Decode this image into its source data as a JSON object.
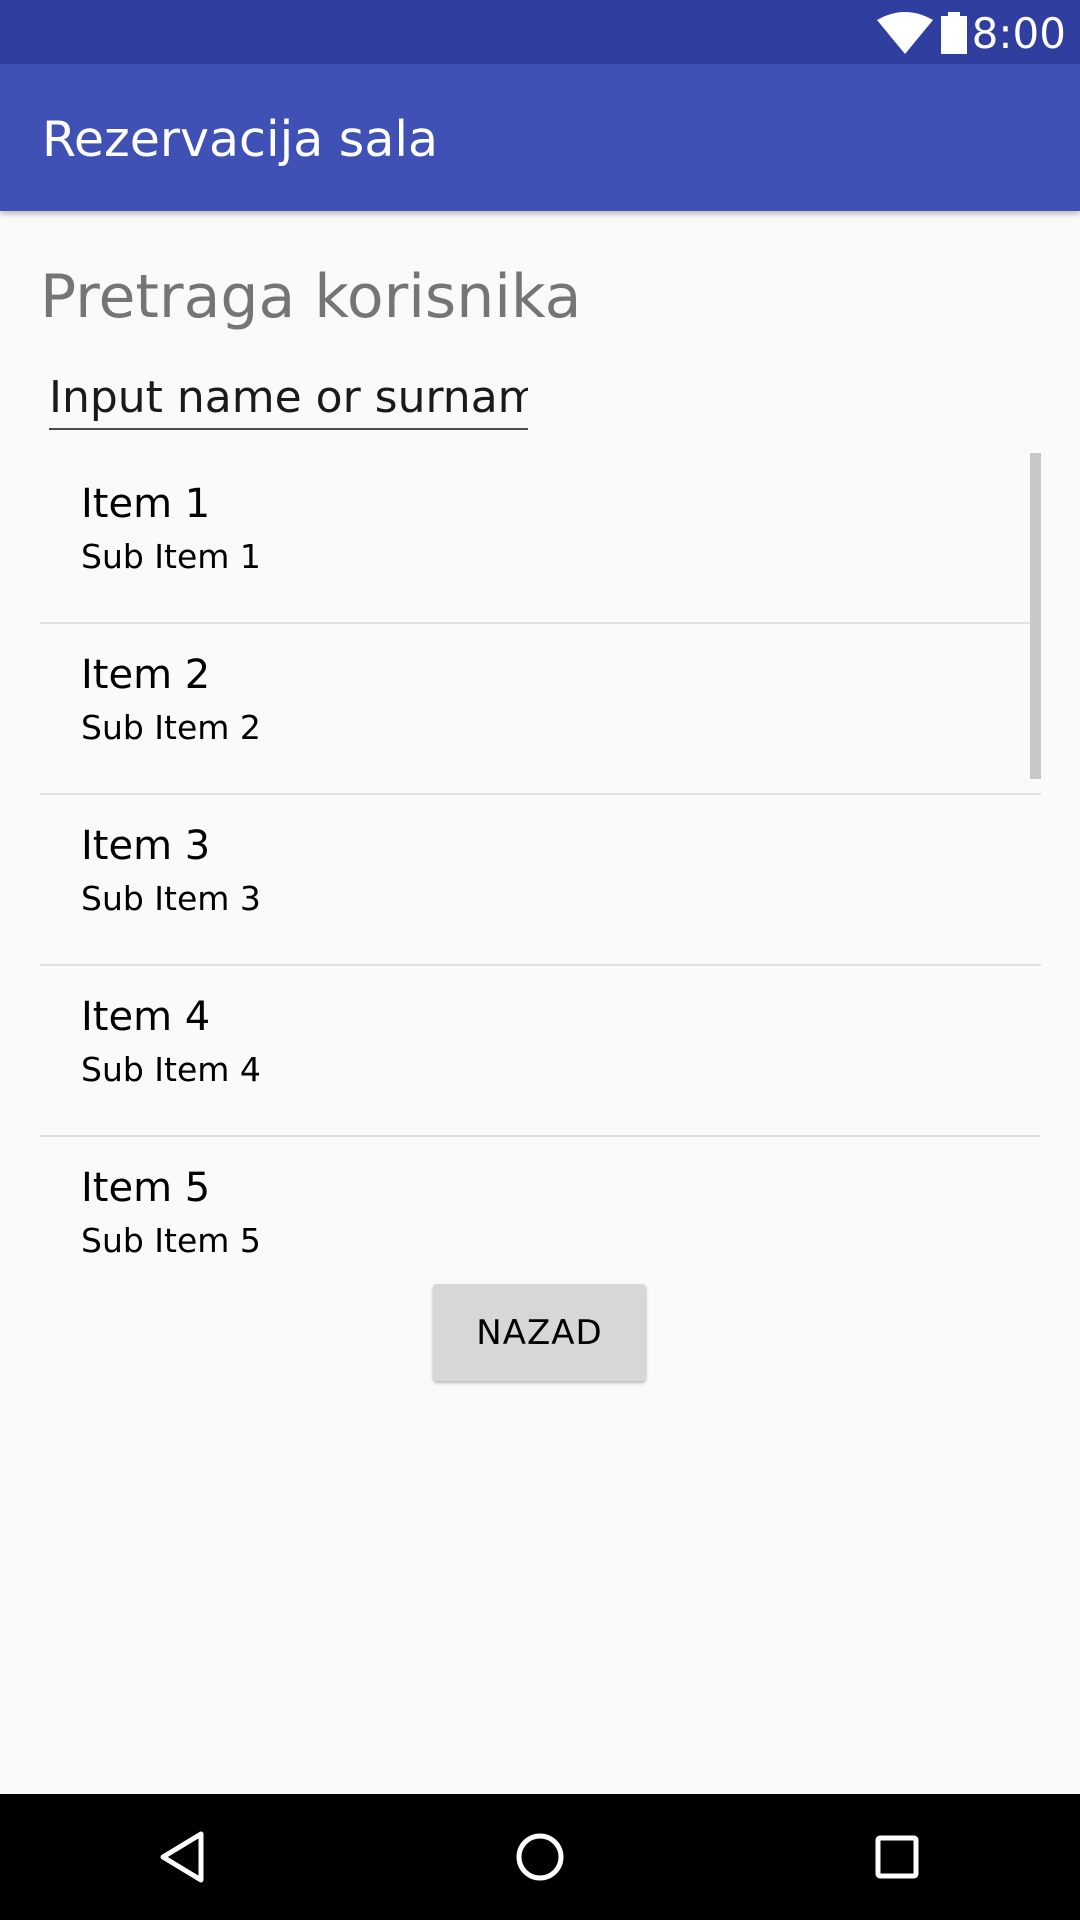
{
  "status_bar": {
    "time": "8:00",
    "icons": [
      "wifi-icon",
      "battery-icon"
    ]
  },
  "app_bar": {
    "title": "Rezervacija sala"
  },
  "page": {
    "heading": "Pretraga korisnika"
  },
  "search": {
    "placeholder": "Input name or surname",
    "value": ""
  },
  "list": {
    "items": [
      {
        "title": "Item 1",
        "subtitle": "Sub Item 1"
      },
      {
        "title": "Item 2",
        "subtitle": "Sub Item 2"
      },
      {
        "title": "Item 3",
        "subtitle": "Sub Item 3"
      },
      {
        "title": "Item 4",
        "subtitle": "Sub Item 4"
      },
      {
        "title": "Item 5",
        "subtitle": "Sub Item 5"
      }
    ]
  },
  "actions": {
    "back_label": "NAZAD"
  },
  "nav_bar": {
    "buttons": [
      "back-triangle-icon",
      "home-circle-icon",
      "recent-square-icon"
    ]
  },
  "colors": {
    "status_bar": "#303f9f",
    "app_bar": "#3f51b5",
    "background": "#fafafa",
    "button": "#d6d7d7",
    "heading_text": "#757575"
  }
}
